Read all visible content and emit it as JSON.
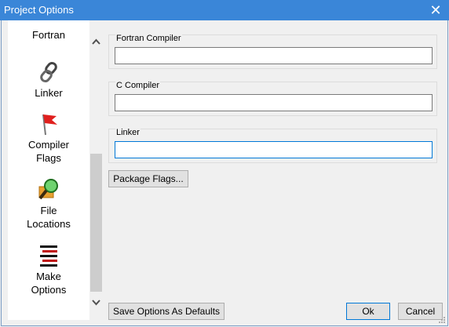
{
  "window": {
    "title": "Project Options",
    "close_symbol": "✕"
  },
  "sidebar": {
    "items": [
      {
        "label": "Fortran",
        "icon": "fortran-icon"
      },
      {
        "label": "Linker",
        "icon": "chain-link-icon"
      },
      {
        "label": "Compiler\nFlags",
        "icon": "red-flag-icon"
      },
      {
        "label": "File\nLocations",
        "icon": "magnifier-folder-icon"
      },
      {
        "label": "Make\nOptions",
        "icon": "make-lines-icon"
      }
    ]
  },
  "scrollbar": {
    "up_arrow": "⌃",
    "down_arrow": "⌄"
  },
  "fields": {
    "fortran_compiler": {
      "label": "Fortran Compiler",
      "value": ""
    },
    "c_compiler": {
      "label": "C Compiler",
      "value": ""
    },
    "linker": {
      "label": "Linker",
      "value": ""
    }
  },
  "buttons": {
    "package_flags": "Package Flags...",
    "save_defaults": "Save Options As Defaults",
    "ok": "Ok",
    "cancel": "Cancel"
  },
  "colors": {
    "titlebar": "#3a86d8",
    "accent": "#0078d7",
    "flag_red": "#e0201e"
  }
}
